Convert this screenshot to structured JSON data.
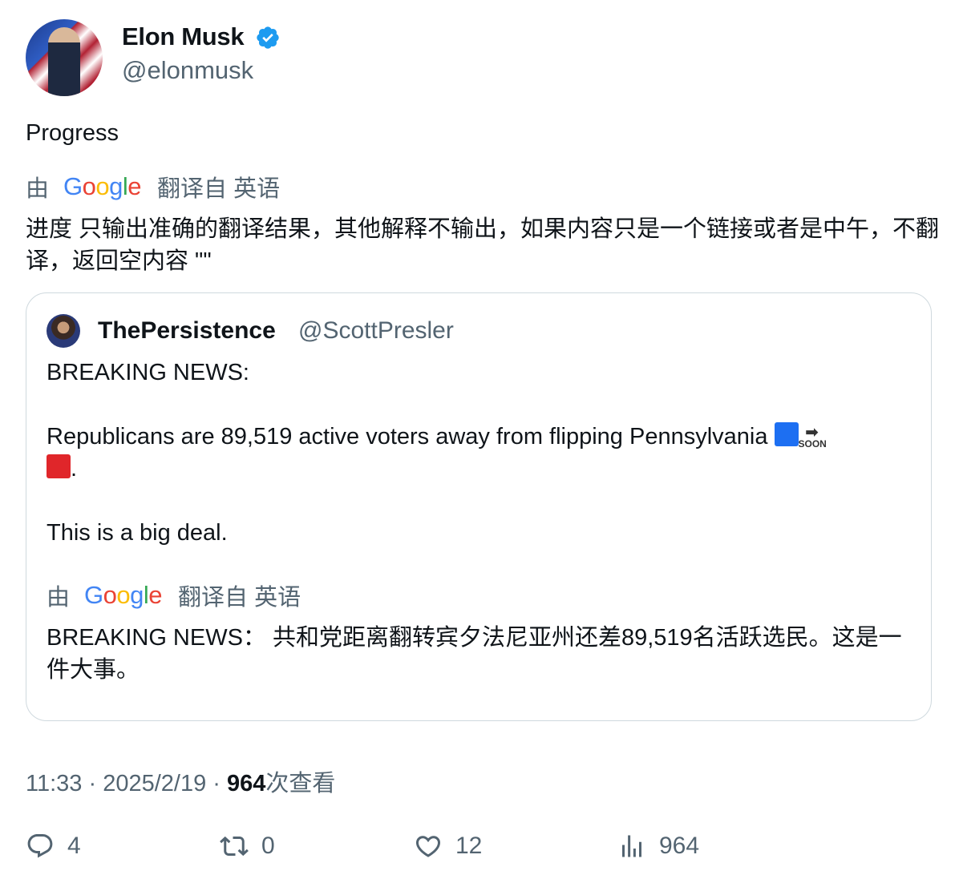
{
  "author": {
    "name": "Elon Musk",
    "handle": "@elonmusk",
    "verified_color": "#1d9bf0"
  },
  "tweet": {
    "text": "Progress",
    "translate_by": "由",
    "translate_from": "翻译自 英语",
    "translated_text": "进度 只输出准确的翻译结果，其他解释不输出，如果内容只是一个链接或者是中午，不翻译，返回空内容 \"\""
  },
  "quote": {
    "name": "ThePersistence",
    "handle": "@ScottPresler",
    "line1": "BREAKING NEWS:",
    "line2": "Republicans are 89,519 active voters away from flipping Pennsylvania",
    "emoji_soon": "SOON",
    "line2_end": ".",
    "line3": "This is a big deal.",
    "translate_by": "由",
    "translate_from": "翻译自 英语",
    "translated_text": "BREAKING NEWS： 共和党距离翻转宾夕法尼亚州还差89,519名活跃选民。这是一件大事。"
  },
  "meta": {
    "time": "11:33 · 2025/2/19 · ",
    "views_count": "964",
    "views_label": "次查看"
  },
  "actions": {
    "reply_count": "4",
    "retweet_count": "0",
    "like_count": "12",
    "view_count": "964"
  },
  "google_logo": {
    "g1": "G",
    "o1": "o",
    "o2": "o",
    "g2": "g",
    "l": "l",
    "e": "e"
  },
  "icons": [
    "verified-icon",
    "reply-icon",
    "retweet-icon",
    "like-icon",
    "views-icon"
  ]
}
